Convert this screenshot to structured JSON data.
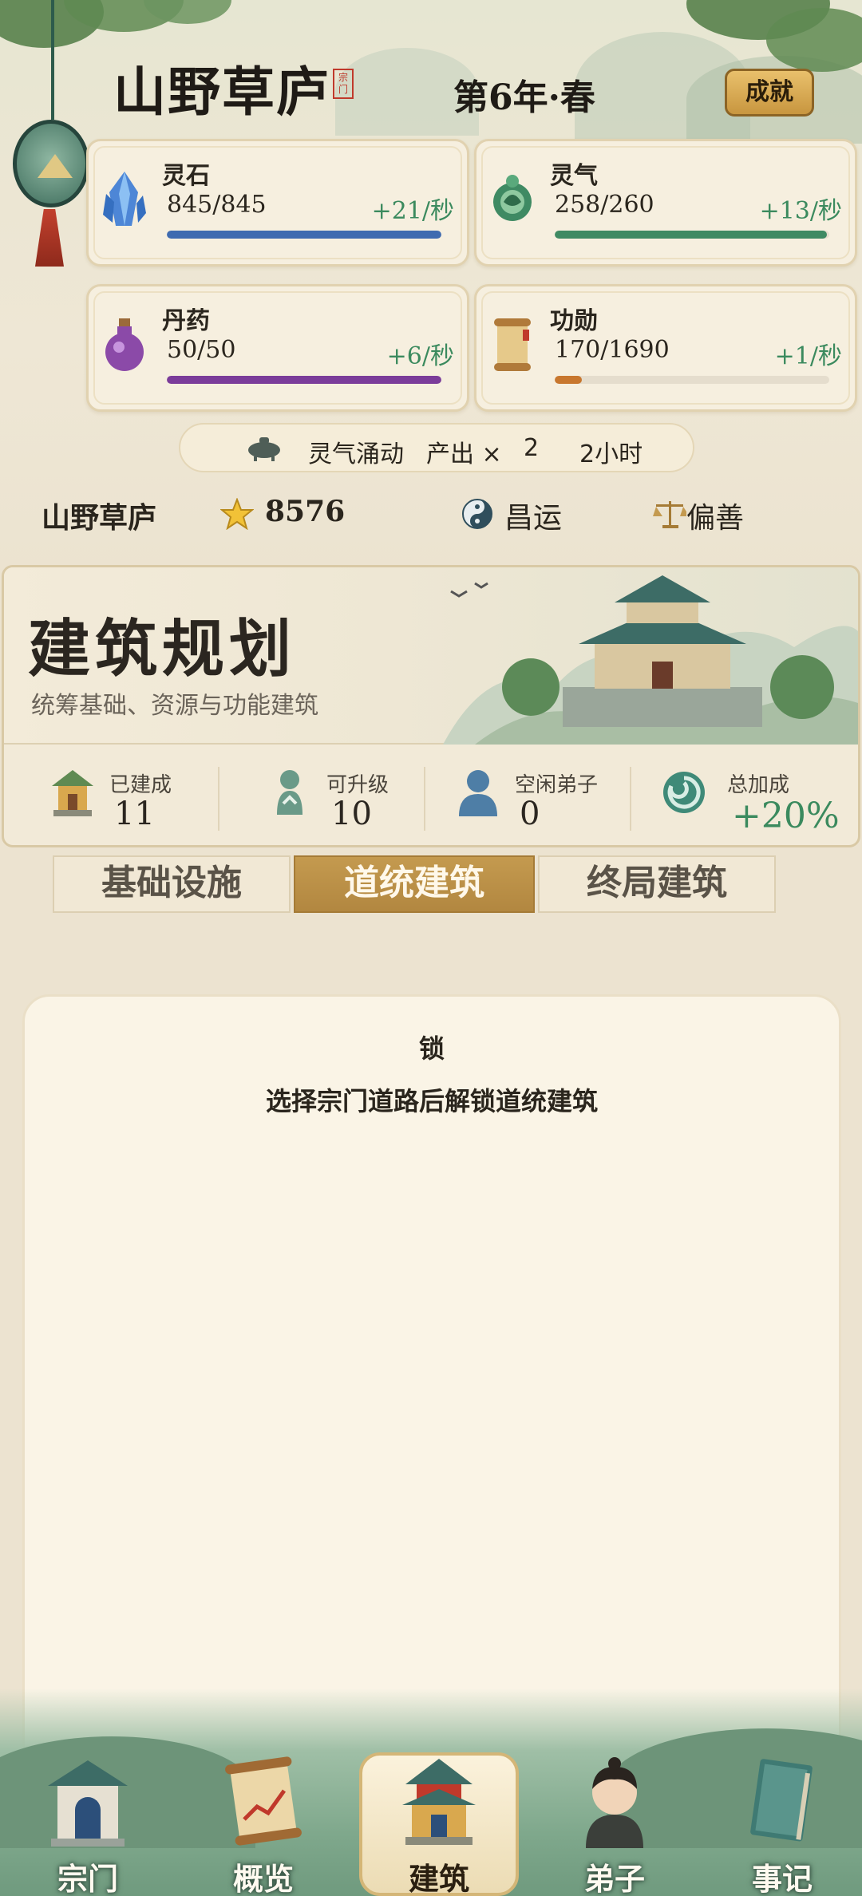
{
  "header": {
    "title": "山野草庐",
    "seal": "宗门",
    "year": "第6年·春",
    "achievement_label": "成就"
  },
  "resources": [
    {
      "name": "灵石",
      "amount": "845/845",
      "rate": "+21/秒",
      "fill": 1.0,
      "color": "#3f6bb0",
      "icon": "crystal-icon"
    },
    {
      "name": "灵气",
      "amount": "258/260",
      "rate": "+13/秒",
      "fill": 0.99,
      "color": "#3f8a63",
      "icon": "qi-orb-icon"
    },
    {
      "name": "丹药",
      "amount": "50/50",
      "rate": "+6/秒",
      "fill": 1.0,
      "color": "#7b3c9a",
      "icon": "potion-icon"
    },
    {
      "name": "功勋",
      "amount": "170/1690",
      "rate": "+1/秒",
      "fill": 0.1,
      "color": "#c8772e",
      "icon": "scroll-icon"
    }
  ],
  "buff": {
    "name": "灵气涌动",
    "effect": "产出 ×",
    "multiplier": "2",
    "duration": "2小时",
    "icon": "censer-icon"
  },
  "info": {
    "sect_name": "山野草庐",
    "score": "8576",
    "fortune": "昌运",
    "alignment": "偏善"
  },
  "banner": {
    "title": "建筑规划",
    "subtitle": "统筹基础、资源与功能建筑",
    "stats": [
      {
        "label": "已建成",
        "value": "11",
        "icon": "pavilion-icon"
      },
      {
        "label": "可升级",
        "value": "10",
        "icon": "upgrade-icon"
      },
      {
        "label": "空闲弟子",
        "value": "0",
        "icon": "person-icon"
      },
      {
        "label": "总加成",
        "value": "+20%",
        "icon": "swirl-icon"
      }
    ]
  },
  "tabs": [
    {
      "label": "基础设施",
      "active": false
    },
    {
      "label": "道统建筑",
      "active": true
    },
    {
      "label": "终局建筑",
      "active": false
    }
  ],
  "panel": {
    "lock_title": "锁",
    "lock_message": "选择宗门道路后解锁道统建筑"
  },
  "nav": [
    {
      "label": "宗门",
      "icon": "gate-icon",
      "active": false
    },
    {
      "label": "概览",
      "icon": "chart-scroll-icon",
      "active": false
    },
    {
      "label": "建筑",
      "icon": "pagoda-icon",
      "active": true
    },
    {
      "label": "弟子",
      "icon": "disciple-icon",
      "active": false
    },
    {
      "label": "事记",
      "icon": "book-icon",
      "active": false
    }
  ]
}
